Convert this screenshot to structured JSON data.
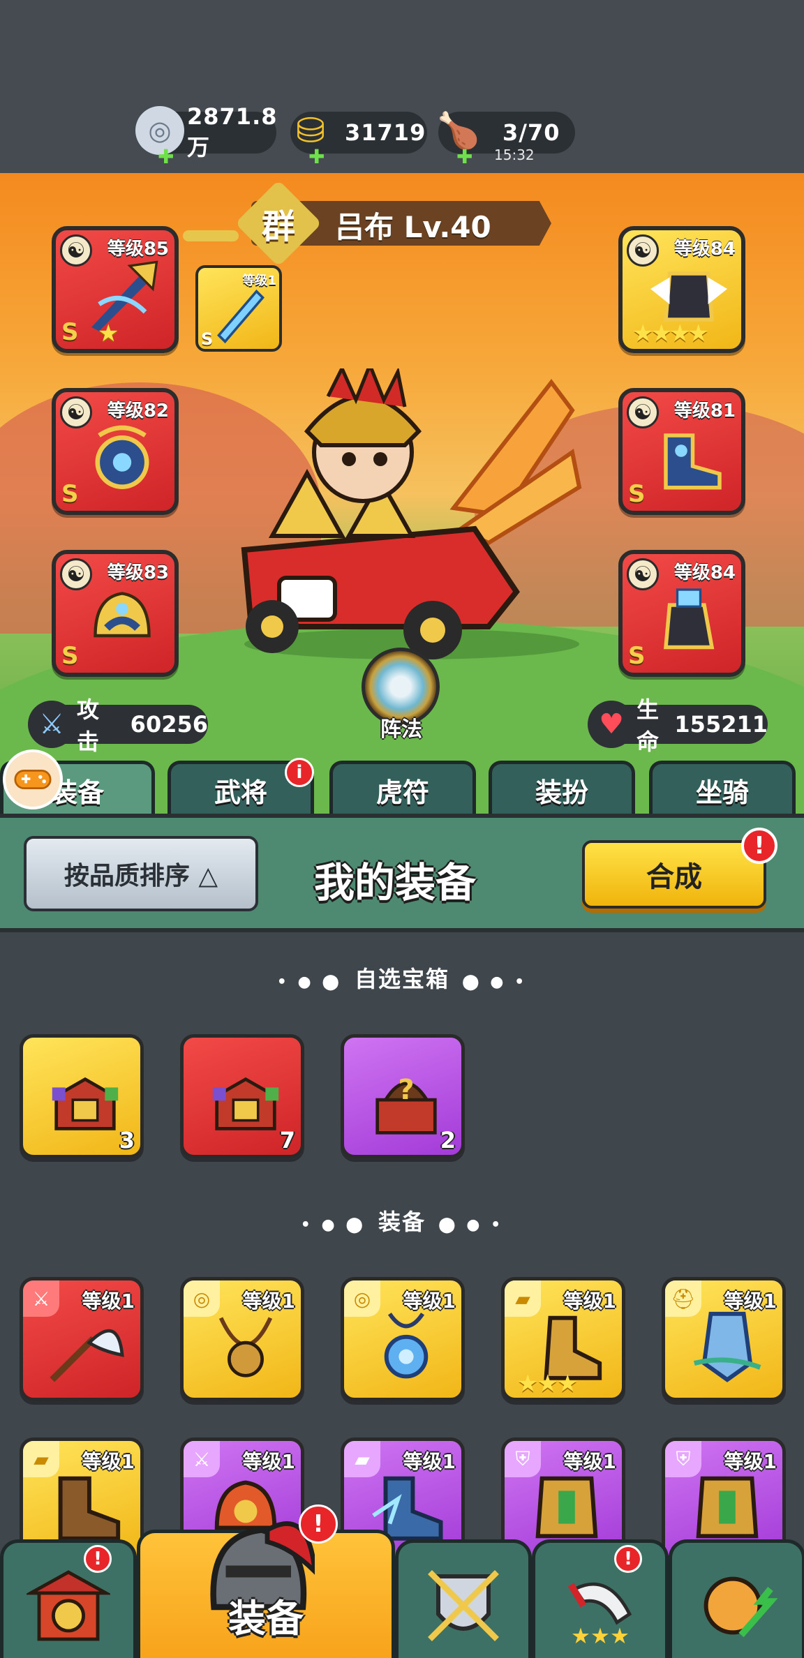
{
  "resources": {
    "silver": "2871.8万",
    "gold": "31719",
    "stamina": "3/70",
    "stamina_timer": "15:32"
  },
  "hero": {
    "faction": "群",
    "name": "吕布  Lv.40",
    "formation_label": "阵法",
    "attack_label": "攻击",
    "attack_value": "60256",
    "hp_label": "生命",
    "hp_value": "155211"
  },
  "equipped_slots": {
    "left_top_level": "等级85",
    "left_mid_level": "等级82",
    "left_bot_level": "等级83",
    "right_top_level": "等级84",
    "right_mid_level": "等级81",
    "right_bot_level": "等级84",
    "small_level": "等级1",
    "grade": "S",
    "left_top_stars": "★",
    "right_top_stars": "★★★★"
  },
  "tabs": [
    {
      "label": "装备"
    },
    {
      "label": "武将",
      "badge": "i"
    },
    {
      "label": "虎符"
    },
    {
      "label": "装扮"
    },
    {
      "label": "坐骑"
    }
  ],
  "panel": {
    "sort_label": "按品质排序 △",
    "title": "我的装备",
    "merge_label": "合成",
    "merge_badge": "!"
  },
  "sections": {
    "chest_title": "自选宝箱",
    "equip_title": "装备",
    "dots_left": "• ● ⬤",
    "dots_right": "⬤ ● •"
  },
  "chests": [
    {
      "count": "3",
      "rarity": "gold"
    },
    {
      "count": "7",
      "rarity": "red"
    },
    {
      "count": "2",
      "rarity": "purple"
    }
  ],
  "equipment_row1": [
    {
      "level": "等级1",
      "rarity": "red"
    },
    {
      "level": "等级1",
      "rarity": "gold"
    },
    {
      "level": "等级1",
      "rarity": "gold"
    },
    {
      "level": "等级1",
      "rarity": "gold",
      "stars": "★★★"
    },
    {
      "level": "等级1",
      "rarity": "gold"
    }
  ],
  "equipment_row2": [
    {
      "level": "等级1",
      "rarity": "gold"
    },
    {
      "level": "等级1",
      "rarity": "purple"
    },
    {
      "level": "等级1",
      "rarity": "purple"
    },
    {
      "level": "等级1",
      "rarity": "purple"
    },
    {
      "level": "等级1",
      "rarity": "purple"
    }
  ],
  "bottom_nav": {
    "active_label": "装备",
    "badge": "!"
  },
  "colors": {
    "accent_gold": "#f1b617",
    "rarity_red": "#cf2428",
    "rarity_purple": "#a33bd8",
    "panel_green": "#4e8a71",
    "badge_red": "#e8262a"
  }
}
